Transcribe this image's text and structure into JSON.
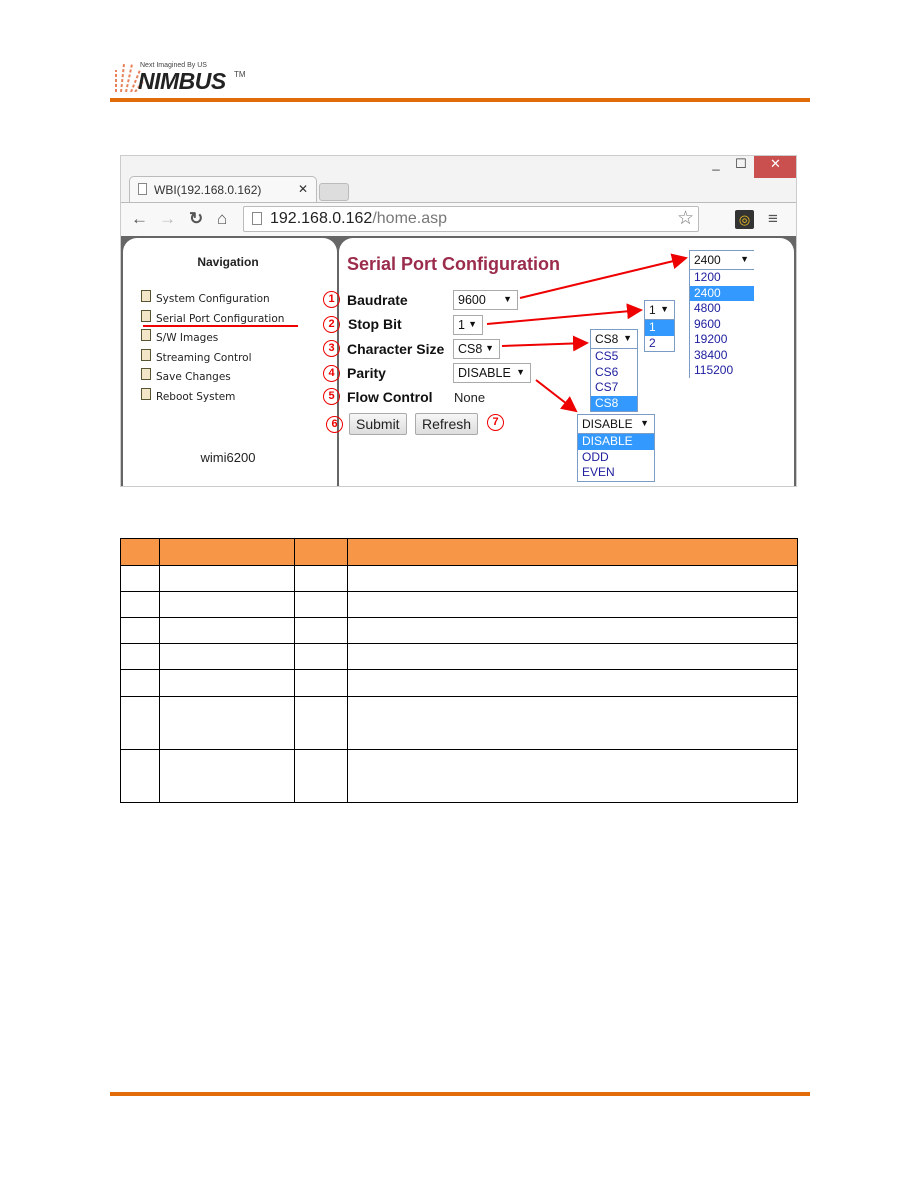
{
  "logo": {
    "tagline": "Next Imagined By US",
    "name": "NIMBUS",
    "tm": "TM"
  },
  "browser": {
    "tab_title": "WBI(192.168.0.162)",
    "url_host": "192.168.0.162",
    "url_path": "/home.asp"
  },
  "nav": {
    "title": "Navigation",
    "items": [
      "System Configuration",
      "Serial Port Configuration",
      "S/W Images",
      "Streaming Control",
      "Save Changes",
      "Reboot System"
    ],
    "active": "Serial Port Configuration",
    "hostname": "wimi6200"
  },
  "form": {
    "title": "Serial Port Configuration",
    "fields": [
      {
        "num": "1",
        "label": "Baudrate",
        "value": "9600"
      },
      {
        "num": "2",
        "label": "Stop Bit",
        "value": "1"
      },
      {
        "num": "3",
        "label": "Character Size",
        "value": "CS8"
      },
      {
        "num": "4",
        "label": "Parity",
        "value": "DISABLE"
      },
      {
        "num": "5",
        "label": "Flow Control",
        "value": "None"
      }
    ],
    "submit": {
      "num": "6",
      "label": "Submit"
    },
    "refresh": {
      "num": "7",
      "label": "Refresh"
    }
  },
  "dropdowns": {
    "baudrate": {
      "selected": "2400",
      "options": [
        "1200",
        "2400",
        "4800",
        "9600",
        "19200",
        "38400",
        "115200"
      ]
    },
    "stopbit": {
      "selected": "1",
      "options": [
        "1",
        "2"
      ]
    },
    "charsize": {
      "selected": "CS8",
      "options": [
        "CS5",
        "CS6",
        "CS7",
        "CS8"
      ]
    },
    "parity": {
      "selected": "DISABLE",
      "options": [
        "DISABLE",
        "ODD",
        "EVEN"
      ]
    }
  },
  "colors": {
    "accent": "#e36c0a",
    "table_header": "#f79646",
    "title": "#9b2c4c",
    "annotation": "#e00000",
    "highlight": "#3399ff"
  }
}
